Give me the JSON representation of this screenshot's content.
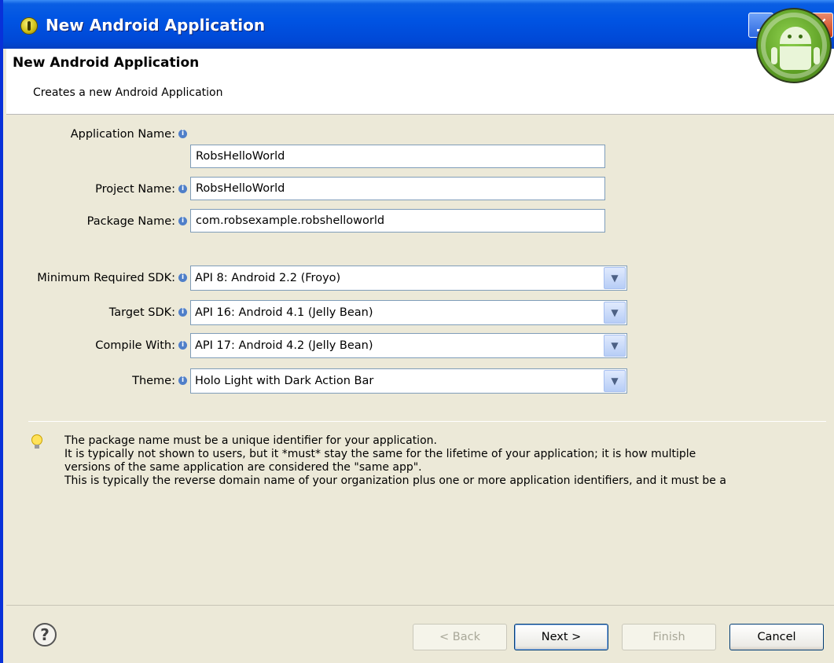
{
  "window": {
    "title": "New Android Application"
  },
  "header": {
    "title": "New Android Application",
    "subtitle": "Creates a new Android Application"
  },
  "form": {
    "application_name": {
      "label": "Application Name:",
      "value": "RobsHelloWorld"
    },
    "project_name": {
      "label": "Project Name:",
      "value": "RobsHelloWorld"
    },
    "package_name": {
      "label": "Package Name:",
      "value": "com.robsexample.robshelloworld"
    },
    "min_sdk": {
      "label": "Minimum Required SDK:",
      "value": "API 8: Android 2.2 (Froyo)"
    },
    "target_sdk": {
      "label": "Target SDK:",
      "value": "API 16: Android 4.1 (Jelly Bean)"
    },
    "compile_with": {
      "label": "Compile With:",
      "value": "API 17: Android 4.2 (Jelly Bean)"
    },
    "theme": {
      "label": "Theme:",
      "value": "Holo Light with Dark Action Bar"
    }
  },
  "hint": {
    "lines": [
      "The package name must be a unique identifier for your application.",
      "It is typically not shown to users, but it *must* stay the same for the lifetime of your application; it is how multiple",
      "versions of the same application are considered the \"same app\".",
      "This is typically the reverse domain name of your organization plus one or more application identifiers, and it must be a"
    ]
  },
  "buttons": {
    "back": "< Back",
    "next": "Next >",
    "finish": "Finish",
    "cancel": "Cancel"
  },
  "icons": {
    "app": "eclipse-app-icon",
    "badge": "android-logo-icon",
    "info": "info-icon",
    "hint": "lightbulb-icon",
    "help": "help-icon"
  }
}
